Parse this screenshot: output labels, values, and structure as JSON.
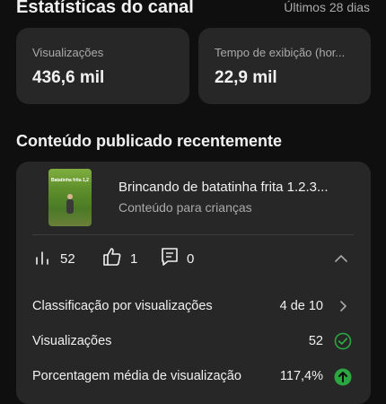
{
  "header": {
    "title": "Estatísticas do canal",
    "period": "Últimos 28 dias"
  },
  "stats": [
    {
      "label": "Visualizações",
      "value": "436,6 mil"
    },
    {
      "label": "Tempo de exibição (hor...",
      "value": "22,9 mil"
    }
  ],
  "recent": {
    "title": "Conteúdo publicado recentemente",
    "video": {
      "thumbnail_caption": "Batatinha frita 1,2,3",
      "title": "Brincando de batatinha frita 1.2.3...",
      "subtitle": "Conteúdo para crianças"
    },
    "metrics": {
      "views": "52",
      "likes": "1",
      "comments": "0"
    },
    "details": [
      {
        "label": "Classificação por visualizações",
        "value": "4 de 10"
      },
      {
        "label": "Visualizações",
        "value": "52"
      },
      {
        "label": "Porcentagem média de visualização",
        "value": "117,4%"
      }
    ]
  },
  "colors": {
    "background": "#0f0f0f",
    "card": "#272727",
    "check_green": "#2ba640",
    "up_green": "#2ba640"
  }
}
